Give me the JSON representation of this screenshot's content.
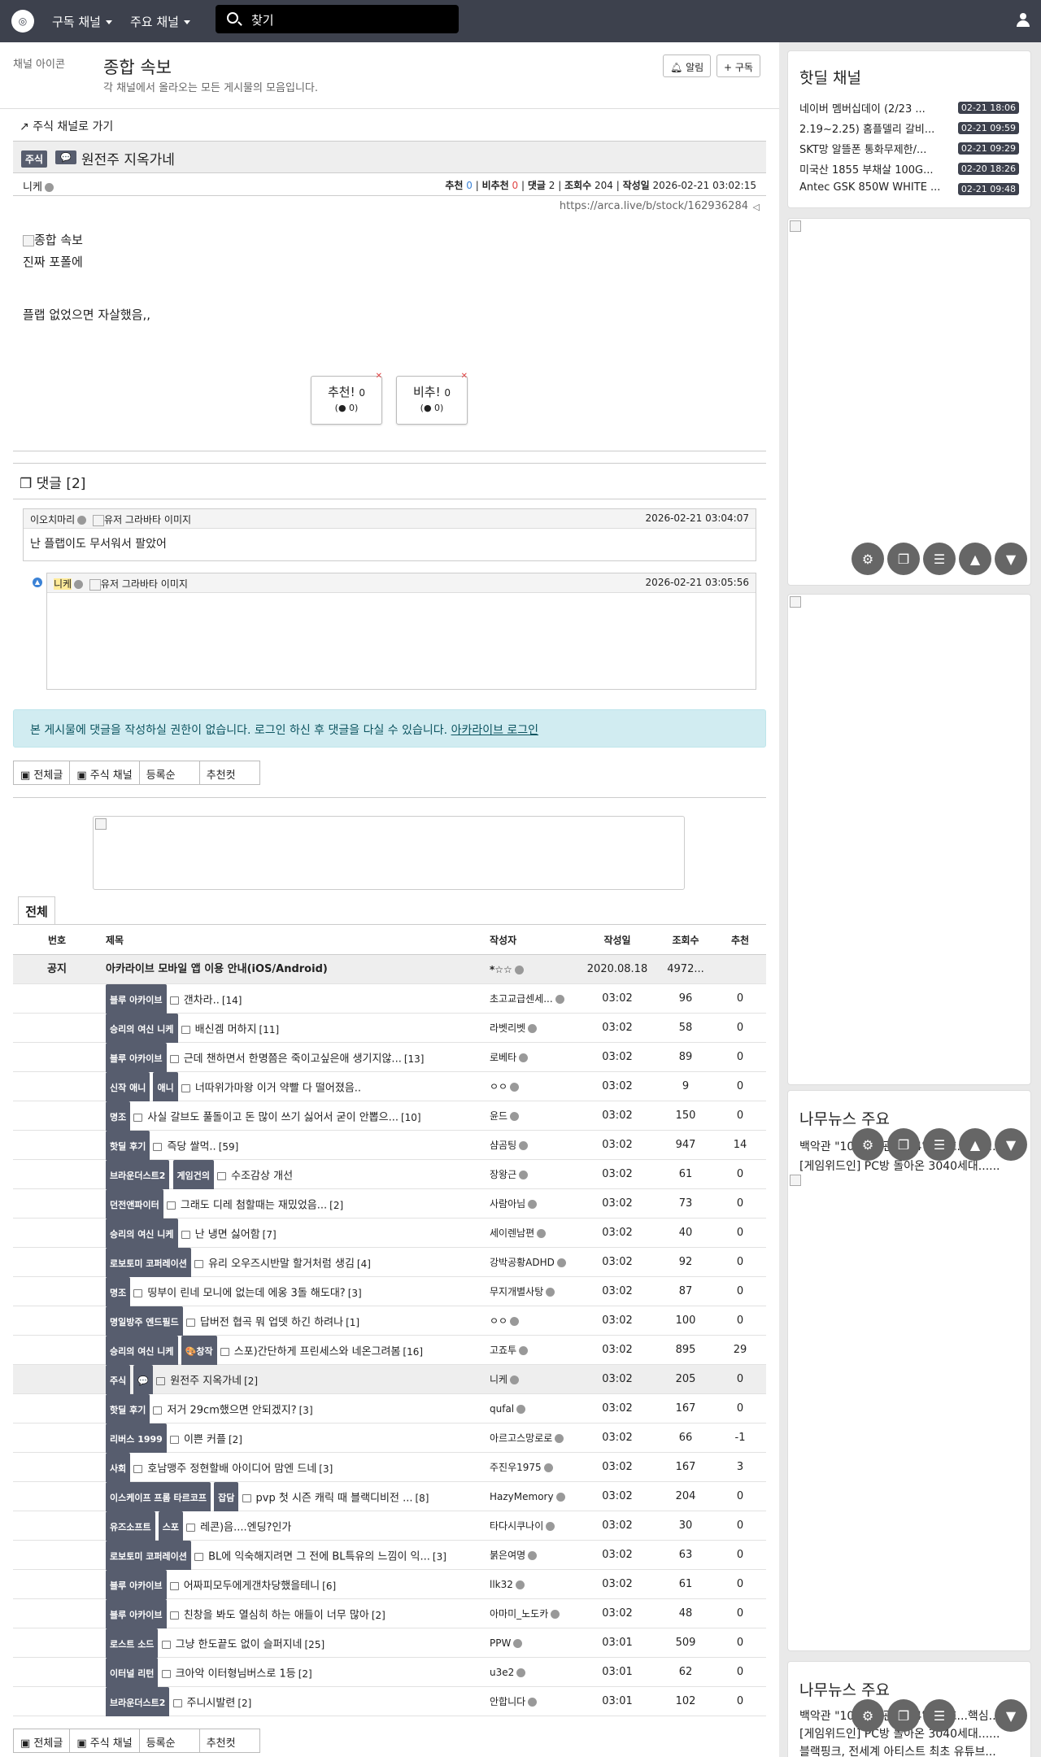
{
  "nav": {
    "logo": "arca",
    "menu1": "구독 채널",
    "menu2": "주요 채널",
    "search_placeholder": "찾기"
  },
  "channel": {
    "icon_alt": "채널 아이콘",
    "title": "종합 속보",
    "desc": "각 채널에서 올라오는 모든 게시물의 모음입니다.",
    "alarm": "알림",
    "subscribe": "구독"
  },
  "post": {
    "back": "주식 채널로 가기",
    "category": "주식",
    "title": "원전주 지옥가네",
    "author": "니케",
    "rec_label": "추천",
    "rec": "0",
    "unrec_label": "비추천",
    "unrec": "0",
    "comments_label": "댓글",
    "comments": "2",
    "views_label": "조회수",
    "views": "204",
    "date_label": "작성일",
    "date": "2026-02-21 03:02:15",
    "url": "https://arca.live/b/stock/162936284",
    "img_alt": "종합 속보",
    "line1": "진짜 포폴에",
    "line2": "플랩 없었으면 자살했음,,",
    "vote_up": "추천!",
    "vote_up_count": "0",
    "vote_up_sub": "0",
    "vote_down": "비추!",
    "vote_down_count": "0",
    "vote_down_sub": "0"
  },
  "comments": {
    "header": "댓글 [2]",
    "c1": {
      "author": "이오치마리",
      "avatar_alt": "유저 그라바타 이미지",
      "time": "2026-02-21 03:04:07",
      "text": "난 플랩이도 무서워서 팔았어"
    },
    "c2": {
      "author": "니케",
      "avatar_alt": "유저 그라바타 이미지",
      "time": "2026-02-21 03:05:56"
    }
  },
  "login_notice": {
    "text": "본 게시물에 댓글을 작성하실 권한이 없습니다. 로그인 하신 후 댓글을 다실 수 있습니다.",
    "link": "아카라이브 로그인"
  },
  "filters": [
    "전체글",
    "주식 채널",
    "등록순",
    "추천컷"
  ],
  "tab_all": "전체",
  "list_header": {
    "num": "번호",
    "title": "제목",
    "author": "작성자",
    "date": "작성일",
    "views": "조회수",
    "rec": "추천"
  },
  "notice_row": {
    "num": "공지",
    "title": "아카라이브 모바일 앱 이용 안내(iOS/Android)",
    "author": "*☆☆",
    "date": "2020.08.18",
    "views": "4972..."
  },
  "rows": [
    {
      "b1": "블루 아카이브",
      "b2": "",
      "title": "갠차라..",
      "cmt": "[14]",
      "author": "초고교급센세...",
      "date": "03:02",
      "views": "96",
      "rec": "0"
    },
    {
      "b1": "승리의 여신 니케",
      "b2": "",
      "title": "배신겜 머하지",
      "cmt": "[11]",
      "author": "라벳리벳",
      "date": "03:02",
      "views": "58",
      "rec": "0"
    },
    {
      "b1": "블루 아카이브",
      "b2": "",
      "title": "근데 챈하면서 한명쯤은 죽이고싶은애 생기지않...",
      "cmt": "[13]",
      "author": "로베타",
      "date": "03:02",
      "views": "89",
      "rec": "0"
    },
    {
      "b1": "신작 애니",
      "b2": "애니",
      "title": "너따위가마왕 이거 약빨 다 떨어졌음..",
      "cmt": "",
      "author": "ㅇㅇ",
      "date": "03:02",
      "views": "9",
      "rec": "0"
    },
    {
      "b1": "명조",
      "b2": "",
      "title": "사실 갈브도 풀돌이고 돈 많이 쓰기 싫어서 굳이 안뽑으...",
      "cmt": "[10]",
      "author": "윤드",
      "date": "03:02",
      "views": "150",
      "rec": "0"
    },
    {
      "b1": "핫딜 후기",
      "b2": "",
      "title": "즉당 쌀먹..",
      "cmt": "[59]",
      "author": "샴곰팅",
      "date": "03:02",
      "views": "947",
      "rec": "14"
    },
    {
      "b1": "브라운더스트2",
      "b2": "게임건의",
      "title": "수조감상 개선",
      "cmt": "",
      "author": "장왕근",
      "date": "03:02",
      "views": "61",
      "rec": "0"
    },
    {
      "b1": "던전앤파이터",
      "b2": "",
      "title": "그래도 디레 첨할때는 재밌었음...",
      "cmt": "[2]",
      "author": "사람아님",
      "date": "03:02",
      "views": "73",
      "rec": "0"
    },
    {
      "b1": "승리의 여신 니케",
      "b2": "",
      "title": "난 냉면 싫어함",
      "cmt": "[7]",
      "author": "세이렌남편",
      "date": "03:02",
      "views": "40",
      "rec": "0"
    },
    {
      "b1": "로보토미 코퍼레이션",
      "b2": "",
      "title": "유리 오우즈시반말 할거처럼 생김",
      "cmt": "[4]",
      "author": "강박공황ADHD",
      "date": "03:02",
      "views": "92",
      "rec": "0"
    },
    {
      "b1": "명조",
      "b2": "",
      "title": "띵부이 린네 모니에 없는데 에옹 3돌 해도대?",
      "cmt": "[3]",
      "author": "무지개별사탕",
      "date": "03:02",
      "views": "87",
      "rec": "0"
    },
    {
      "b1": "명일방주 엔드필드",
      "b2": "",
      "title": "답버전 협곡 뭐 업뎃 하긴 하려나",
      "cmt": "[1]",
      "author": "ㅇㅇ",
      "date": "03:02",
      "views": "100",
      "rec": "0"
    },
    {
      "b1": "승리의 여신 니케",
      "b2": "🎨창작",
      "title": "스포)간단하게 프린세스와 네온그려봄",
      "cmt": "[16]",
      "author": "고죠투",
      "date": "03:02",
      "views": "895",
      "rec": "29"
    },
    {
      "b1": "주식",
      "b2": "💬",
      "title": "원전주 지옥가네",
      "cmt": "[2]",
      "author": "니케",
      "date": "03:02",
      "views": "205",
      "rec": "0"
    },
    {
      "b1": "핫딜 후기",
      "b2": "",
      "title": "저거 29cm했으면 안되겠지?",
      "cmt": "[3]",
      "author": "qufal",
      "date": "03:02",
      "views": "167",
      "rec": "0"
    },
    {
      "b1": "리버스 1999",
      "b2": "",
      "title": "이쁜 커플",
      "cmt": "[2]",
      "author": "아르고스망로로",
      "date": "03:02",
      "views": "66",
      "rec": "-1"
    },
    {
      "b1": "사회",
      "b2": "",
      "title": "호남맹주 정현할배 아이디어 맘엔 드네",
      "cmt": "[3]",
      "author": "주진우1975",
      "date": "03:02",
      "views": "167",
      "rec": "3"
    },
    {
      "b1": "이스케이프 프롬 타르코프",
      "b2": "잡담",
      "title": "pvp 첫 시즌 캐릭 때 블랙디비전 ...",
      "cmt": "[8]",
      "author": "HazyMemory",
      "date": "03:02",
      "views": "204",
      "rec": "0"
    },
    {
      "b1": "유즈소프트",
      "b2": "스포",
      "title": "레콘)음....엔딩?인가",
      "cmt": "",
      "author": "타다시쿠나이",
      "date": "03:02",
      "views": "30",
      "rec": "0"
    },
    {
      "b1": "로보토미 코퍼레이션",
      "b2": "",
      "title": "BL에 익숙해지려면 그 전에 BL특유의 느낌이 익...",
      "cmt": "[3]",
      "author": "붉은여명",
      "date": "03:02",
      "views": "63",
      "rec": "0"
    },
    {
      "b1": "블루 아카이브",
      "b2": "",
      "title": "어짜피모두에게갠차당했을테니",
      "cmt": "[6]",
      "author": "llk32",
      "date": "03:02",
      "views": "61",
      "rec": "0"
    },
    {
      "b1": "블루 아카이브",
      "b2": "",
      "title": "친창을 봐도 열심히 하는 애들이 너무 많아",
      "cmt": "[2]",
      "author": "아마미_노도카",
      "date": "03:02",
      "views": "48",
      "rec": "0"
    },
    {
      "b1": "로스트 소드",
      "b2": "",
      "title": "그냥 한도끝도 없이 슬퍼지네",
      "cmt": "[25]",
      "author": "PPW",
      "date": "03:01",
      "views": "509",
      "rec": "0"
    },
    {
      "b1": "이터널 리턴",
      "b2": "",
      "title": "크아악 이터형님버스로 1등",
      "cmt": "[2]",
      "author": "u3e2",
      "date": "03:01",
      "views": "62",
      "rec": "0"
    },
    {
      "b1": "브라운더스트2",
      "b2": "",
      "title": "주니시발련",
      "cmt": "[2]",
      "author": "안합니다",
      "date": "03:01",
      "views": "102",
      "rec": "0"
    }
  ],
  "sidebar": {
    "hot_title": "핫딜 채널",
    "hot": [
      {
        "title": "네이버 멤버십데이 (2/23 ...",
        "time": "02-21 18:06"
      },
      {
        "title": "2.19~2.25) 홈플델리 갈비...",
        "time": "02-21 09:59"
      },
      {
        "title": "SKT망 알뜰폰 통화무제한/...",
        "time": "02-21 09:29"
      },
      {
        "title": "미국산 1855 부채살 100G...",
        "time": "02-20 18:26"
      },
      {
        "title": "Antec GSK 850W WHITE ...",
        "time": "02-21 09:48"
      }
    ],
    "news_title": "나무뉴스 주요",
    "news": [
      "백악관 \"10% 새 관세 24일 발효...핵심...",
      "[게임위드인] PC방 돌아온 3040세대......"
    ],
    "news_title2": "나무뉴스 주요",
    "news2": [
      "백악관 \"10% 새 관세 24일 발효...핵심...",
      "[게임위드인] PC방 돌아온 3040세대......",
      "블랙핑크, 전세계 아티스트 최초 유튜브..."
    ]
  }
}
